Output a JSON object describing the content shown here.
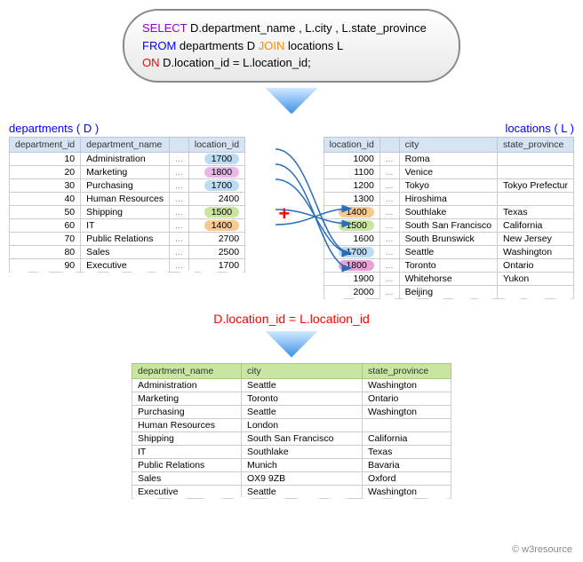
{
  "sql": {
    "select_kw": "SELECT",
    "select_cols": " D.department_name , L.city , L.state_province",
    "from_kw": "FROM",
    "from_text": "  departments D ",
    "join_kw": "JOIN",
    "join_text": " locations L",
    "on_kw": "ON",
    "on_text": "  D.location_id = L.location_id;"
  },
  "labels": {
    "departments": "departments ( D )",
    "locations": "locations ( L )",
    "join_condition": "D.location_id = L.location_id",
    "attribution": "© w3resource",
    "plus": "+"
  },
  "departments": {
    "headers": [
      "department_id",
      "department_name",
      "",
      "location_id"
    ],
    "rows": [
      {
        "id": "10",
        "name": "Administration",
        "dots": "...",
        "loc": "1700",
        "pill": "c-blue"
      },
      {
        "id": "20",
        "name": "Marketing",
        "dots": "...",
        "loc": "1800",
        "pill": "c-pink"
      },
      {
        "id": "30",
        "name": "Purchasing",
        "dots": "...",
        "loc": "1700",
        "pill": "c-blue"
      },
      {
        "id": "40",
        "name": "Human Resources",
        "dots": "...",
        "loc": "2400",
        "pill": ""
      },
      {
        "id": "50",
        "name": "Shipping",
        "dots": "...",
        "loc": "1500",
        "pill": "c-green"
      },
      {
        "id": "60",
        "name": "IT",
        "dots": "...",
        "loc": "1400",
        "pill": "c-orange"
      },
      {
        "id": "70",
        "name": "Public Relations",
        "dots": "...",
        "loc": "2700",
        "pill": ""
      },
      {
        "id": "80",
        "name": "Sales",
        "dots": "...",
        "loc": "2500",
        "pill": ""
      },
      {
        "id": "90",
        "name": "Executive",
        "dots": "...",
        "loc": "1700",
        "pill": ""
      }
    ]
  },
  "locations": {
    "headers": [
      "location_id",
      "",
      "city",
      "state_province"
    ],
    "rows": [
      {
        "loc": "1000",
        "dots": "...",
        "city": "Roma",
        "state": "",
        "pill": ""
      },
      {
        "loc": "1100",
        "dots": "...",
        "city": "Venice",
        "state": "",
        "pill": ""
      },
      {
        "loc": "1200",
        "dots": "...",
        "city": "Tokyo",
        "state": "Tokyo Prefectur",
        "pill": ""
      },
      {
        "loc": "1300",
        "dots": "...",
        "city": "Hiroshima",
        "state": "",
        "pill": ""
      },
      {
        "loc": "1400",
        "dots": "...",
        "city": "Southlake",
        "state": "Texas",
        "pill": "c-orange"
      },
      {
        "loc": "1500",
        "dots": "...",
        "city": "South San Francisco",
        "state": "California",
        "pill": "c-green"
      },
      {
        "loc": "1600",
        "dots": "...",
        "city": "South Brunswick",
        "state": "New Jersey",
        "pill": ""
      },
      {
        "loc": "1700",
        "dots": "...",
        "city": "Seattle",
        "state": "Washington",
        "pill": "c-blue"
      },
      {
        "loc": "1800",
        "dots": "...",
        "city": "Toronto",
        "state": "Ontario",
        "pill": "c-magenta"
      },
      {
        "loc": "1900",
        "dots": "...",
        "city": "Whitehorse",
        "state": "Yukon",
        "pill": ""
      },
      {
        "loc": "2000",
        "dots": "...",
        "city": "Beijing",
        "state": "",
        "pill": ""
      }
    ]
  },
  "result": {
    "headers": [
      "department_name",
      "city",
      "state_province"
    ],
    "rows": [
      {
        "dept": "Administration",
        "city": "Seattle",
        "state": "Washington"
      },
      {
        "dept": "Marketing",
        "city": "Toronto",
        "state": "Ontario"
      },
      {
        "dept": "Purchasing",
        "city": "Seattle",
        "state": "Washington"
      },
      {
        "dept": "Human Resources",
        "city": "London",
        "state": ""
      },
      {
        "dept": "Shipping",
        "city": "South San Francisco",
        "state": "California"
      },
      {
        "dept": "IT",
        "city": "Southlake",
        "state": "Texas"
      },
      {
        "dept": "Public Relations",
        "city": "Munich",
        "state": "Bavaria"
      },
      {
        "dept": "Sales",
        "city": "OX9 9ZB",
        "state": "Oxford"
      },
      {
        "dept": "Executive",
        "city": "Seattle",
        "state": "Washington"
      }
    ]
  }
}
